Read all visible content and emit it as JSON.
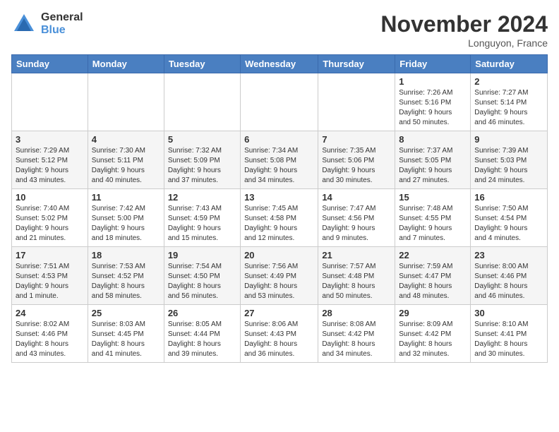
{
  "header": {
    "logo_general": "General",
    "logo_blue": "Blue",
    "title": "November 2024",
    "location": "Longuyon, France"
  },
  "weekdays": [
    "Sunday",
    "Monday",
    "Tuesday",
    "Wednesday",
    "Thursday",
    "Friday",
    "Saturday"
  ],
  "weeks": [
    [
      {
        "day": "",
        "info": ""
      },
      {
        "day": "",
        "info": ""
      },
      {
        "day": "",
        "info": ""
      },
      {
        "day": "",
        "info": ""
      },
      {
        "day": "",
        "info": ""
      },
      {
        "day": "1",
        "info": "Sunrise: 7:26 AM\nSunset: 5:16 PM\nDaylight: 9 hours\nand 50 minutes."
      },
      {
        "day": "2",
        "info": "Sunrise: 7:27 AM\nSunset: 5:14 PM\nDaylight: 9 hours\nand 46 minutes."
      }
    ],
    [
      {
        "day": "3",
        "info": "Sunrise: 7:29 AM\nSunset: 5:12 PM\nDaylight: 9 hours\nand 43 minutes."
      },
      {
        "day": "4",
        "info": "Sunrise: 7:30 AM\nSunset: 5:11 PM\nDaylight: 9 hours\nand 40 minutes."
      },
      {
        "day": "5",
        "info": "Sunrise: 7:32 AM\nSunset: 5:09 PM\nDaylight: 9 hours\nand 37 minutes."
      },
      {
        "day": "6",
        "info": "Sunrise: 7:34 AM\nSunset: 5:08 PM\nDaylight: 9 hours\nand 34 minutes."
      },
      {
        "day": "7",
        "info": "Sunrise: 7:35 AM\nSunset: 5:06 PM\nDaylight: 9 hours\nand 30 minutes."
      },
      {
        "day": "8",
        "info": "Sunrise: 7:37 AM\nSunset: 5:05 PM\nDaylight: 9 hours\nand 27 minutes."
      },
      {
        "day": "9",
        "info": "Sunrise: 7:39 AM\nSunset: 5:03 PM\nDaylight: 9 hours\nand 24 minutes."
      }
    ],
    [
      {
        "day": "10",
        "info": "Sunrise: 7:40 AM\nSunset: 5:02 PM\nDaylight: 9 hours\nand 21 minutes."
      },
      {
        "day": "11",
        "info": "Sunrise: 7:42 AM\nSunset: 5:00 PM\nDaylight: 9 hours\nand 18 minutes."
      },
      {
        "day": "12",
        "info": "Sunrise: 7:43 AM\nSunset: 4:59 PM\nDaylight: 9 hours\nand 15 minutes."
      },
      {
        "day": "13",
        "info": "Sunrise: 7:45 AM\nSunset: 4:58 PM\nDaylight: 9 hours\nand 12 minutes."
      },
      {
        "day": "14",
        "info": "Sunrise: 7:47 AM\nSunset: 4:56 PM\nDaylight: 9 hours\nand 9 minutes."
      },
      {
        "day": "15",
        "info": "Sunrise: 7:48 AM\nSunset: 4:55 PM\nDaylight: 9 hours\nand 7 minutes."
      },
      {
        "day": "16",
        "info": "Sunrise: 7:50 AM\nSunset: 4:54 PM\nDaylight: 9 hours\nand 4 minutes."
      }
    ],
    [
      {
        "day": "17",
        "info": "Sunrise: 7:51 AM\nSunset: 4:53 PM\nDaylight: 9 hours\nand 1 minute."
      },
      {
        "day": "18",
        "info": "Sunrise: 7:53 AM\nSunset: 4:52 PM\nDaylight: 8 hours\nand 58 minutes."
      },
      {
        "day": "19",
        "info": "Sunrise: 7:54 AM\nSunset: 4:50 PM\nDaylight: 8 hours\nand 56 minutes."
      },
      {
        "day": "20",
        "info": "Sunrise: 7:56 AM\nSunset: 4:49 PM\nDaylight: 8 hours\nand 53 minutes."
      },
      {
        "day": "21",
        "info": "Sunrise: 7:57 AM\nSunset: 4:48 PM\nDaylight: 8 hours\nand 50 minutes."
      },
      {
        "day": "22",
        "info": "Sunrise: 7:59 AM\nSunset: 4:47 PM\nDaylight: 8 hours\nand 48 minutes."
      },
      {
        "day": "23",
        "info": "Sunrise: 8:00 AM\nSunset: 4:46 PM\nDaylight: 8 hours\nand 46 minutes."
      }
    ],
    [
      {
        "day": "24",
        "info": "Sunrise: 8:02 AM\nSunset: 4:46 PM\nDaylight: 8 hours\nand 43 minutes."
      },
      {
        "day": "25",
        "info": "Sunrise: 8:03 AM\nSunset: 4:45 PM\nDaylight: 8 hours\nand 41 minutes."
      },
      {
        "day": "26",
        "info": "Sunrise: 8:05 AM\nSunset: 4:44 PM\nDaylight: 8 hours\nand 39 minutes."
      },
      {
        "day": "27",
        "info": "Sunrise: 8:06 AM\nSunset: 4:43 PM\nDaylight: 8 hours\nand 36 minutes."
      },
      {
        "day": "28",
        "info": "Sunrise: 8:08 AM\nSunset: 4:42 PM\nDaylight: 8 hours\nand 34 minutes."
      },
      {
        "day": "29",
        "info": "Sunrise: 8:09 AM\nSunset: 4:42 PM\nDaylight: 8 hours\nand 32 minutes."
      },
      {
        "day": "30",
        "info": "Sunrise: 8:10 AM\nSunset: 4:41 PM\nDaylight: 8 hours\nand 30 minutes."
      }
    ]
  ]
}
